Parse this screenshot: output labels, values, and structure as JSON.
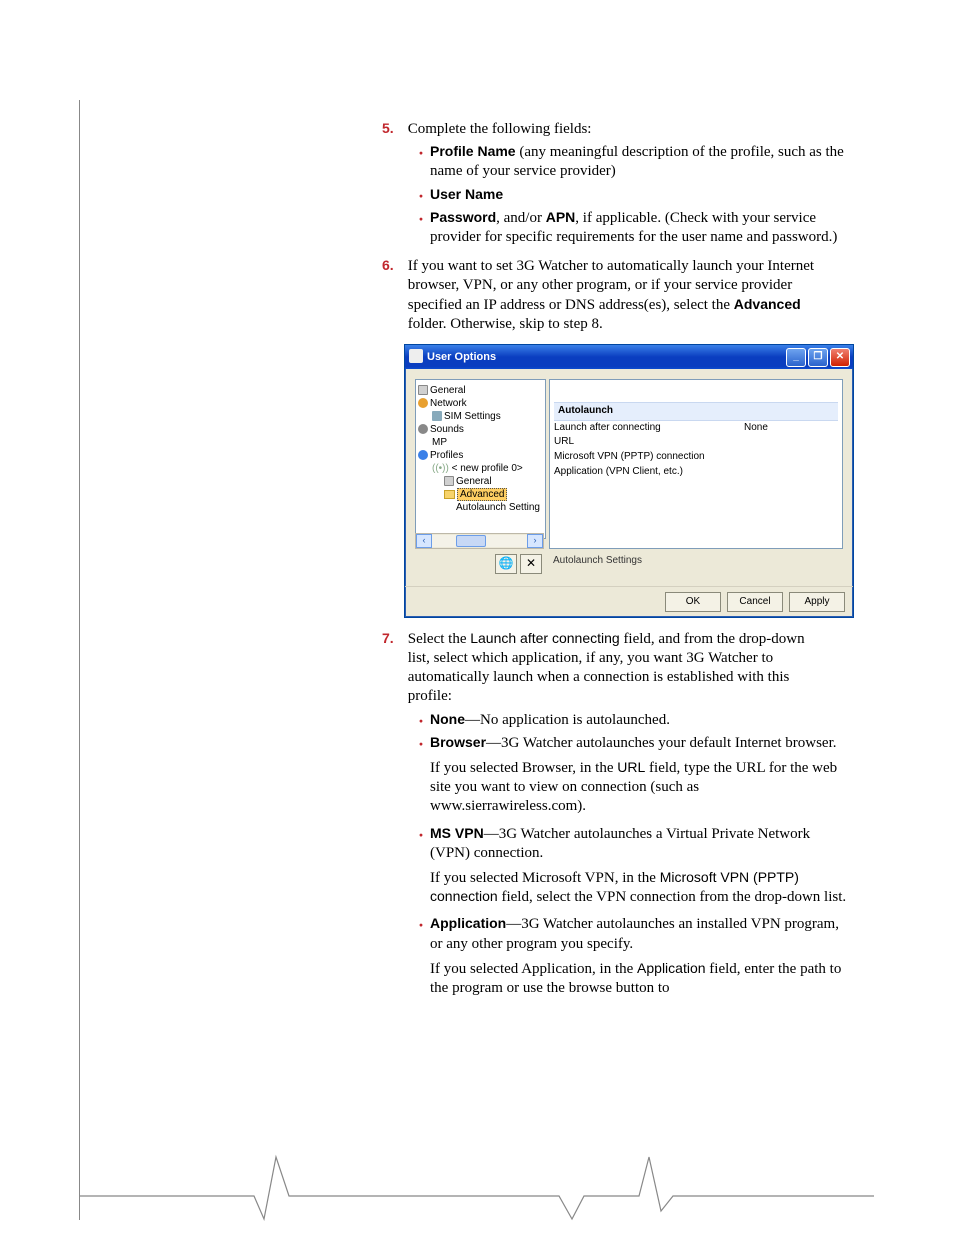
{
  "steps": {
    "s5": {
      "num": "5.",
      "text": "Complete the following fields:"
    },
    "s5_items": {
      "a1_b": "Profile Name",
      "a1_t": " (any meaningful description of the profile, such as the name of your service provider)",
      "a2_b": "User Name",
      "a3_b1": "Password",
      "a3_mid": ", and/or ",
      "a3_b2": "APN",
      "a3_t": ", if applicable. (Check with your service provider for specific requirements for the user name and password.)"
    },
    "s6": {
      "num": "6.",
      "t1": "If you want to set 3G Watcher to automatically launch your Internet browser, VPN, or any other program, or if your service provider specified an IP address or DNS address(es), select the ",
      "b1": "Advanced",
      "t2": " folder. Otherwise, skip to step 8."
    },
    "s7": {
      "num": "7.",
      "t1": "Select the ",
      "s1": "Launch after connecting",
      "t2": " field, and from the drop-down list, select which application, if any, you want 3G Watcher to automatically launch when a connection is established with this profile:"
    },
    "s7_items": {
      "none_b": "None",
      "none_t": "—No application is autolaunched.",
      "browser_b": "Browser",
      "browser_t": "—3G Watcher autolaunches your default Internet browser.",
      "browser_sub_t1": "If you selected Browser, in the ",
      "browser_sub_s": "URL",
      "browser_sub_t2": " field, type the URL for the web site you want to view on connection (such as www.sierrawireless.com).",
      "msvpn_b": "MS VPN",
      "msvpn_t": "—3G Watcher autolaunches a Virtual Private Network (VPN) connection.",
      "msvpn_sub_t1": "If you selected Microsoft VPN, in the ",
      "msvpn_sub_s": "Microsoft VPN (PPTP) connection",
      "msvpn_sub_t2": " field, select the VPN connection from the drop-down list.",
      "app_b": "Application",
      "app_t": "—3G Watcher autolaunches an installed VPN program, or any other program you specify.",
      "app_sub_t1": "If you selected Application, in the ",
      "app_sub_s": "Application",
      "app_sub_t2": " field, enter the path to the program or use the browse button to"
    }
  },
  "dialog": {
    "title": "User Options",
    "tree": {
      "general": "General",
      "network": "Network",
      "sim": "SIM Settings",
      "sounds": "Sounds",
      "mp": "MP",
      "profiles": "Profiles",
      "newprof": "< new profile 0>",
      "pgeneral": "General",
      "advanced": "Advanced",
      "autoset": "Autolaunch Setting"
    },
    "group": "Autolaunch",
    "rows": {
      "r1k": "Launch after connecting",
      "r1v": "None",
      "r2k": "URL",
      "r3k": "Microsoft VPN (PPTP) connection",
      "r4k": "Application (VPN Client, etc.)"
    },
    "desc": "Autolaunch Settings",
    "buttons": {
      "ok": "OK",
      "cancel": "Cancel",
      "apply": "Apply"
    },
    "toolbar": {
      "globe": "🌐",
      "x": "✕"
    },
    "wctrl": {
      "min": "_",
      "max": "❐",
      "close": "✕"
    },
    "scroll": {
      "left": "‹",
      "right": "›"
    }
  }
}
